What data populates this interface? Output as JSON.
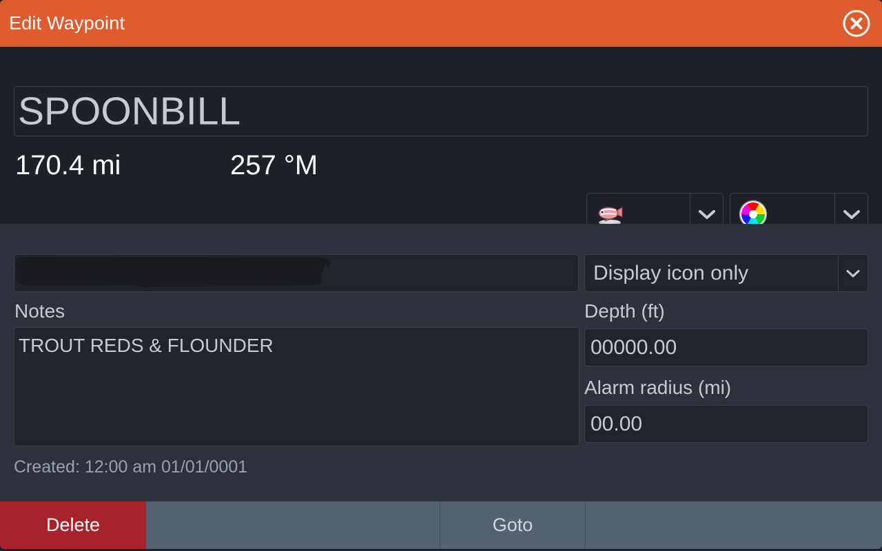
{
  "window": {
    "title": "Edit Waypoint",
    "close_icon": "close-circle-icon",
    "accent_color": "#df5a2c",
    "panel_top_color": "#1e2228",
    "panel_bottom_color": "#2d313c",
    "field_bg_color": "#20242b",
    "border_color": "#3b4048",
    "text_color": "#c7cbd0"
  },
  "waypoint": {
    "name": "SPOONBILL",
    "distance": "170.4 mi",
    "bearing": "257 °M",
    "icon_symbol": "fish-icon",
    "color_symbol": "color-wheel-icon",
    "coordinates_value": "",
    "coordinates_redacted": true,
    "display_mode": "Display icon only",
    "notes_label": "Notes",
    "notes_value": "TROUT REDS & FLOUNDER",
    "depth_label": "Depth (ft)",
    "depth_value": "00000.00",
    "alarm_label": "Alarm radius (mi)",
    "alarm_value": "00.00",
    "created": "Created: 12:00 am  01/01/0001"
  },
  "buttons": {
    "delete": "Delete",
    "blank_left": "",
    "goto": "Goto",
    "blank_right": "",
    "delete_color": "#a7222a",
    "neutral_color": "#54626f"
  },
  "icons": {
    "chevron_down": "chevron-down-icon"
  }
}
